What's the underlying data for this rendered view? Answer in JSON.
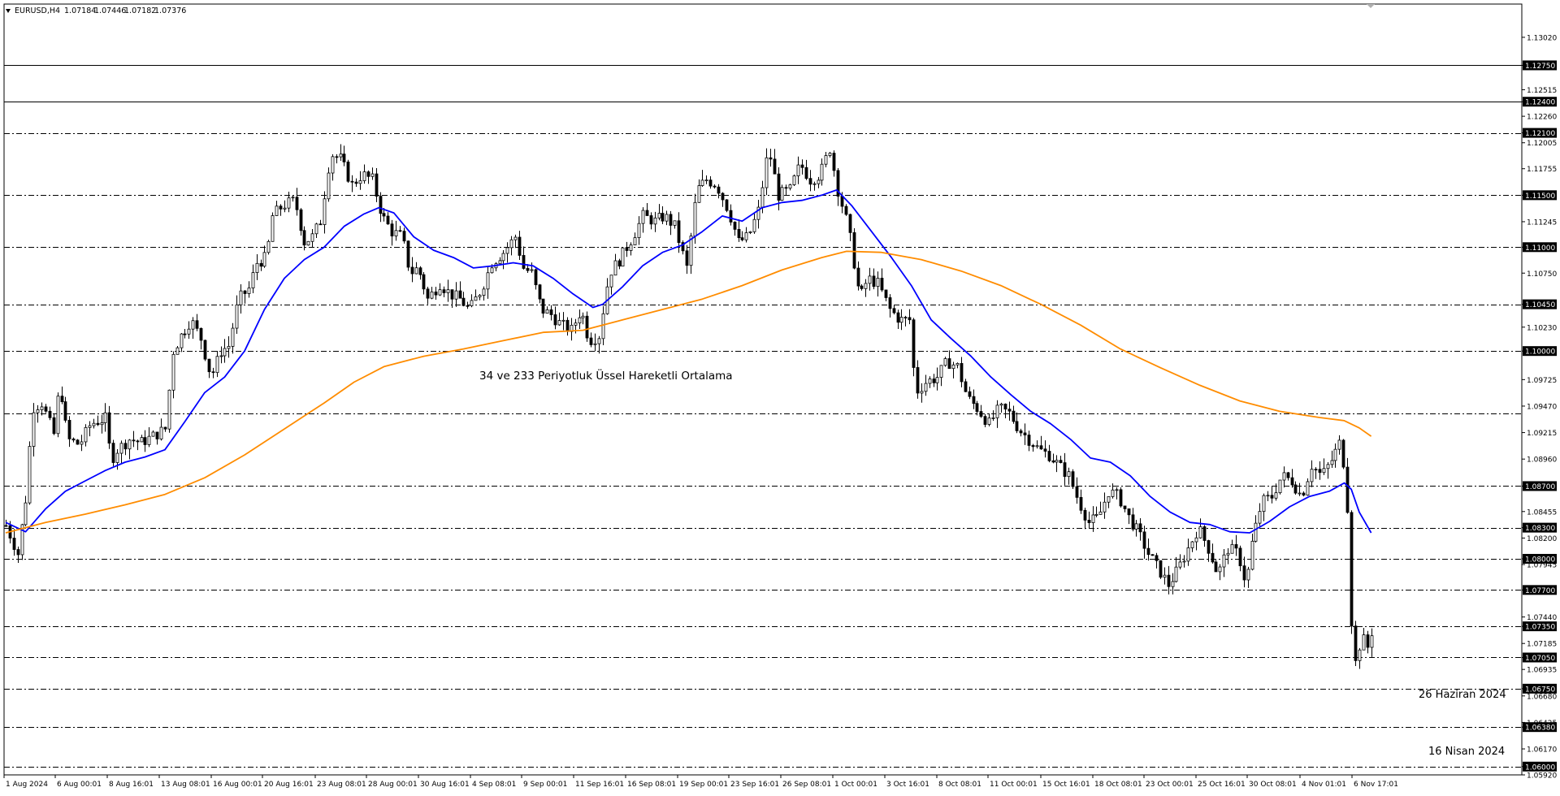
{
  "chart_data": {
    "type": "candlestick",
    "symbol": "EURUSD,H4",
    "ohlc": [
      "1.07184",
      "1.07446",
      "1.07182",
      "1.07376"
    ],
    "ylim": [
      1.0592,
      1.1334
    ],
    "y_ticks": [
      "1.13020",
      "1.12750",
      "1.12515",
      "1.12400",
      "1.12260",
      "1.12100",
      "1.12005",
      "1.11755",
      "1.11500",
      "1.11245",
      "1.11000",
      "1.10750",
      "1.10450",
      "1.10230",
      "1.10000",
      "1.09725",
      "1.09470",
      "1.09215",
      "1.08960",
      "1.08700",
      "1.08455",
      "1.08300",
      "1.08200",
      "1.08000",
      "1.07945",
      "1.07700",
      "1.07440",
      "1.07350",
      "1.07185",
      "1.07050",
      "1.06935",
      "1.06750",
      "1.06680",
      "1.06425",
      "1.06380",
      "1.06170",
      "1.06000",
      "1.05920"
    ],
    "x_ticks": [
      "1 Aug 2024",
      "6 Aug 00:01",
      "8 Aug 16:01",
      "13 Aug 08:01",
      "16 Aug 00:01",
      "20 Aug 16:01",
      "23 Aug 08:01",
      "28 Aug 00:01",
      "30 Aug 16:01",
      "4 Sep 08:01",
      "9 Sep 00:01",
      "11 Sep 16:01",
      "16 Sep 08:01",
      "19 Sep 00:01",
      "23 Sep 16:01",
      "26 Sep 08:01",
      "1 Oct 00:01",
      "3 Oct 16:01",
      "8 Oct 08:01",
      "11 Oct 00:01",
      "15 Oct 16:01",
      "18 Oct 08:01",
      "23 Oct 00:01",
      "25 Oct 16:01",
      "30 Oct 08:01",
      "4 Nov 01:01",
      "6 Nov 17:01"
    ],
    "horizontal_levels": {
      "solid": [
        "1.12750",
        "1.12400"
      ],
      "dashed": [
        "1.12100",
        "1.11500",
        "1.11000",
        "1.10450",
        "1.10000",
        "1.09400",
        "1.08700",
        "1.08300",
        "1.08000",
        "1.07700",
        "1.07350",
        "1.07050",
        "1.06750",
        "1.06380",
        "1.06000"
      ]
    },
    "close_path": [
      [
        0,
        1.0832
      ],
      [
        12,
        1.0805
      ],
      [
        22,
        1.087
      ],
      [
        26,
        1.0945
      ],
      [
        36,
        1.095
      ],
      [
        48,
        1.092
      ],
      [
        54,
        1.097
      ],
      [
        62,
        1.0915
      ],
      [
        74,
        1.091
      ],
      [
        85,
        1.093
      ],
      [
        100,
        1.0935
      ],
      [
        106,
        1.0895
      ],
      [
        112,
        1.0905
      ],
      [
        124,
        1.0915
      ],
      [
        136,
        1.0912
      ],
      [
        148,
        1.0918
      ],
      [
        160,
        1.0925
      ],
      [
        168,
        1.1
      ],
      [
        176,
        1.1015
      ],
      [
        186,
        1.103
      ],
      [
        196,
        1.1012
      ],
      [
        206,
        1.0975
      ],
      [
        216,
        1.1
      ],
      [
        224,
        1.1005
      ],
      [
        234,
        1.105
      ],
      [
        244,
        1.106
      ],
      [
        252,
        1.1085
      ],
      [
        262,
        1.109
      ],
      [
        268,
        1.113
      ],
      [
        278,
        1.114
      ],
      [
        290,
        1.1145
      ],
      [
        300,
        1.1105
      ],
      [
        308,
        1.111
      ],
      [
        316,
        1.1125
      ],
      [
        326,
        1.119
      ],
      [
        336,
        1.1185
      ],
      [
        348,
        1.116
      ],
      [
        358,
        1.117
      ],
      [
        368,
        1.1165
      ],
      [
        378,
        1.113
      ],
      [
        388,
        1.1115
      ],
      [
        398,
        1.111
      ],
      [
        406,
        1.1075
      ],
      [
        414,
        1.108
      ],
      [
        424,
        1.105
      ],
      [
        436,
        1.1065
      ],
      [
        446,
        1.1055
      ],
      [
        456,
        1.105
      ],
      [
        466,
        1.104
      ],
      [
        478,
        1.106
      ],
      [
        488,
        1.1085
      ],
      [
        500,
        1.1095
      ],
      [
        512,
        1.111
      ],
      [
        520,
        1.108
      ],
      [
        528,
        1.1075
      ],
      [
        538,
        1.104
      ],
      [
        548,
        1.1035
      ],
      [
        558,
        1.1025
      ],
      [
        568,
        1.102
      ],
      [
        578,
        1.104
      ],
      [
        586,
        1.101
      ],
      [
        596,
        1.1015
      ],
      [
        606,
        1.1075
      ],
      [
        618,
        1.109
      ],
      [
        630,
        1.111
      ],
      [
        640,
        1.113
      ],
      [
        652,
        1.1125
      ],
      [
        662,
        1.113
      ],
      [
        672,
        1.112
      ],
      [
        684,
        1.108
      ],
      [
        694,
        1.1155
      ],
      [
        704,
        1.1165
      ],
      [
        714,
        1.116
      ],
      [
        726,
        1.1135
      ],
      [
        736,
        1.1105
      ],
      [
        746,
        1.111
      ],
      [
        756,
        1.1135
      ],
      [
        766,
        1.1195
      ],
      [
        776,
        1.115
      ],
      [
        788,
        1.1155
      ],
      [
        798,
        1.118
      ],
      [
        808,
        1.1165
      ],
      [
        818,
        1.117
      ],
      [
        828,
        1.1195
      ],
      [
        836,
        1.1155
      ],
      [
        846,
        1.112
      ],
      [
        852,
        1.1085
      ],
      [
        858,
        1.105
      ],
      [
        866,
        1.107
      ],
      [
        876,
        1.1065
      ],
      [
        888,
        1.104
      ],
      [
        898,
        1.103
      ],
      [
        908,
        1.103
      ],
      [
        914,
        1.096
      ],
      [
        924,
        1.097
      ],
      [
        936,
        1.0975
      ],
      [
        946,
        1.099
      ],
      [
        956,
        1.0985
      ],
      [
        966,
        1.0955
      ],
      [
        976,
        1.0945
      ],
      [
        988,
        1.093
      ],
      [
        998,
        1.0945
      ],
      [
        1008,
        1.094
      ],
      [
        1018,
        1.0925
      ],
      [
        1028,
        1.0915
      ],
      [
        1038,
        1.0905
      ],
      [
        1048,
        1.09
      ],
      [
        1058,
        1.089
      ],
      [
        1068,
        1.088
      ],
      [
        1078,
        1.0855
      ],
      [
        1088,
        1.0835
      ],
      [
        1098,
        1.084
      ],
      [
        1108,
        1.0865
      ],
      [
        1118,
        1.086
      ],
      [
        1128,
        1.084
      ],
      [
        1138,
        1.0825
      ],
      [
        1148,
        1.0805
      ],
      [
        1158,
        1.079
      ],
      [
        1168,
        1.0775
      ],
      [
        1178,
        1.079
      ],
      [
        1188,
        1.081
      ],
      [
        1198,
        1.083
      ],
      [
        1208,
        1.081
      ],
      [
        1218,
        1.0785
      ],
      [
        1228,
        1.081
      ],
      [
        1238,
        1.0805
      ],
      [
        1246,
        1.0775
      ],
      [
        1252,
        1.0815
      ],
      [
        1262,
        1.0855
      ],
      [
        1272,
        1.086
      ],
      [
        1282,
        1.088
      ],
      [
        1292,
        1.0875
      ],
      [
        1302,
        1.086
      ],
      [
        1312,
        1.089
      ],
      [
        1322,
        1.088
      ],
      [
        1332,
        1.0895
      ],
      [
        1342,
        1.0915
      ],
      [
        1348,
        1.085
      ],
      [
        1352,
        1.074
      ],
      [
        1356,
        1.07
      ],
      [
        1362,
        1.0725
      ],
      [
        1368,
        1.0715
      ],
      [
        1374,
        1.0737
      ]
    ],
    "series": [
      {
        "name": "34",
        "color": "#0000ff",
        "points": [
          [
            0,
            1.0835
          ],
          [
            20,
            1.0826
          ],
          [
            40,
            1.0848
          ],
          [
            60,
            1.0865
          ],
          [
            80,
            1.0875
          ],
          [
            100,
            1.0885
          ],
          [
            120,
            1.0893
          ],
          [
            140,
            1.0898
          ],
          [
            160,
            1.0905
          ],
          [
            180,
            1.0932
          ],
          [
            200,
            1.096
          ],
          [
            220,
            1.0975
          ],
          [
            240,
            1.1
          ],
          [
            260,
            1.104
          ],
          [
            280,
            1.107
          ],
          [
            300,
            1.1088
          ],
          [
            320,
            1.11
          ],
          [
            340,
            1.112
          ],
          [
            360,
            1.1132
          ],
          [
            375,
            1.1138
          ],
          [
            390,
            1.1133
          ],
          [
            410,
            1.111
          ],
          [
            430,
            1.1097
          ],
          [
            450,
            1.109
          ],
          [
            470,
            1.108
          ],
          [
            490,
            1.1082
          ],
          [
            510,
            1.1085
          ],
          [
            530,
            1.1082
          ],
          [
            550,
            1.107
          ],
          [
            570,
            1.1055
          ],
          [
            590,
            1.1042
          ],
          [
            600,
            1.1045
          ],
          [
            620,
            1.1062
          ],
          [
            640,
            1.1082
          ],
          [
            660,
            1.1095
          ],
          [
            680,
            1.1102
          ],
          [
            700,
            1.1115
          ],
          [
            720,
            1.113
          ],
          [
            740,
            1.1125
          ],
          [
            760,
            1.1138
          ],
          [
            780,
            1.1143
          ],
          [
            800,
            1.1145
          ],
          [
            820,
            1.115
          ],
          [
            835,
            1.1155
          ],
          [
            850,
            1.114
          ],
          [
            870,
            1.1115
          ],
          [
            890,
            1.109
          ],
          [
            910,
            1.1063
          ],
          [
            930,
            1.103
          ],
          [
            950,
            1.1012
          ],
          [
            970,
            1.0995
          ],
          [
            990,
            1.0975
          ],
          [
            1010,
            1.0958
          ],
          [
            1030,
            1.0942
          ],
          [
            1050,
            1.093
          ],
          [
            1070,
            1.0915
          ],
          [
            1090,
            1.0897
          ],
          [
            1110,
            1.0893
          ],
          [
            1130,
            1.088
          ],
          [
            1150,
            1.086
          ],
          [
            1170,
            1.0845
          ],
          [
            1190,
            1.0835
          ],
          [
            1210,
            1.0833
          ],
          [
            1230,
            1.0826
          ],
          [
            1250,
            1.0825
          ],
          [
            1270,
            1.0836
          ],
          [
            1290,
            1.085
          ],
          [
            1310,
            1.086
          ],
          [
            1330,
            1.0865
          ],
          [
            1345,
            1.0873
          ],
          [
            1352,
            1.0867
          ],
          [
            1360,
            1.0845
          ],
          [
            1372,
            1.0825
          ]
        ]
      },
      {
        "name": "233",
        "color": "#ff8c00",
        "points": [
          [
            0,
            1.0825
          ],
          [
            40,
            1.0835
          ],
          [
            80,
            1.0843
          ],
          [
            120,
            1.0852
          ],
          [
            160,
            1.0862
          ],
          [
            200,
            1.0878
          ],
          [
            240,
            1.09
          ],
          [
            280,
            1.0925
          ],
          [
            320,
            1.095
          ],
          [
            350,
            1.097
          ],
          [
            380,
            1.0985
          ],
          [
            420,
            1.0995
          ],
          [
            460,
            1.1002
          ],
          [
            500,
            1.101
          ],
          [
            540,
            1.1018
          ],
          [
            580,
            1.102
          ],
          [
            620,
            1.103
          ],
          [
            660,
            1.104
          ],
          [
            700,
            1.105
          ],
          [
            740,
            1.1063
          ],
          [
            780,
            1.1078
          ],
          [
            820,
            1.109
          ],
          [
            845,
            1.1096
          ],
          [
            880,
            1.1095
          ],
          [
            920,
            1.1088
          ],
          [
            960,
            1.1077
          ],
          [
            1000,
            1.1063
          ],
          [
            1040,
            1.1045
          ],
          [
            1080,
            1.1025
          ],
          [
            1120,
            1.1002
          ],
          [
            1160,
            1.0984
          ],
          [
            1200,
            1.0967
          ],
          [
            1240,
            1.0952
          ],
          [
            1280,
            1.0942
          ],
          [
            1320,
            1.0936
          ],
          [
            1345,
            1.0933
          ],
          [
            1360,
            1.0926
          ],
          [
            1372,
            1.0918
          ]
        ]
      }
    ],
    "annotations": [
      "34 ve 233 Periyotluk Üssel Hareketli Ortalama",
      "26 Haziran 2024",
      "16 Nisan 2024"
    ]
  }
}
